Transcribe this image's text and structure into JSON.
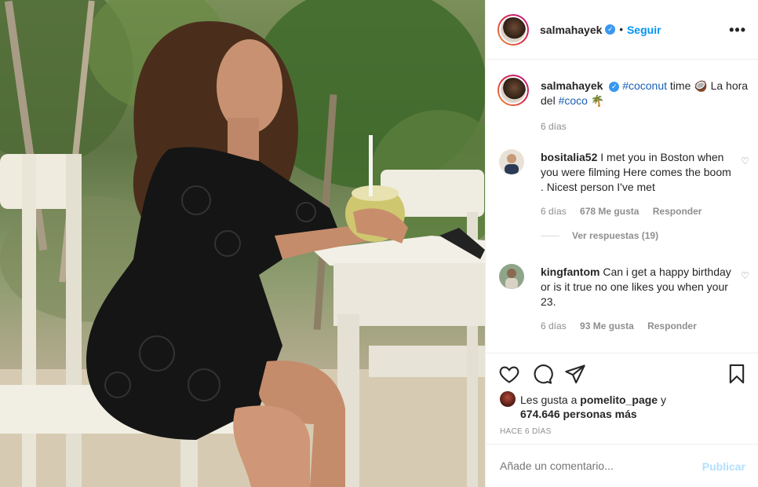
{
  "post": {
    "author": "salmahayek",
    "follow_label": "Seguir",
    "more_label": "•••",
    "verified_icon": "✓"
  },
  "caption": {
    "username": "salmahayek",
    "hashtag1": "#coconut",
    "text1": " time 🥥 La hora del ",
    "hashtag2": "#coco",
    "text2": " 🌴",
    "age": "6 días"
  },
  "comments": [
    {
      "username": "bositalia52",
      "text": "I met you in Boston when you were filming Here comes the boom . Nicest person I've met",
      "age": "6 días",
      "likes": "678 Me gusta",
      "reply_label": "Responder"
    },
    {
      "username": "kingfantom",
      "text": "Can i get a happy birthday or is it true no one likes you when your 23.",
      "age": "6 días",
      "likes": "93 Me gusta",
      "reply_label": "Responder"
    }
  ],
  "view_replies": "Ver respuestas (19)",
  "likes": {
    "prefix": "Les gusta a ",
    "liker": "pomelito_page",
    "connector": " y",
    "count": "674.646 personas más"
  },
  "date": "HACE 6 DÍAS",
  "add_comment": {
    "placeholder": "Añade un comentario...",
    "publish_label": "Publicar"
  },
  "icons": {
    "heart": "♡",
    "like": "heart-icon",
    "comment": "comment-icon",
    "share": "share-icon",
    "save": "bookmark-icon"
  },
  "colors": {
    "accent": "#0095f6",
    "publish_disabled": "#b2dffc",
    "muted": "#8e8e8e"
  }
}
